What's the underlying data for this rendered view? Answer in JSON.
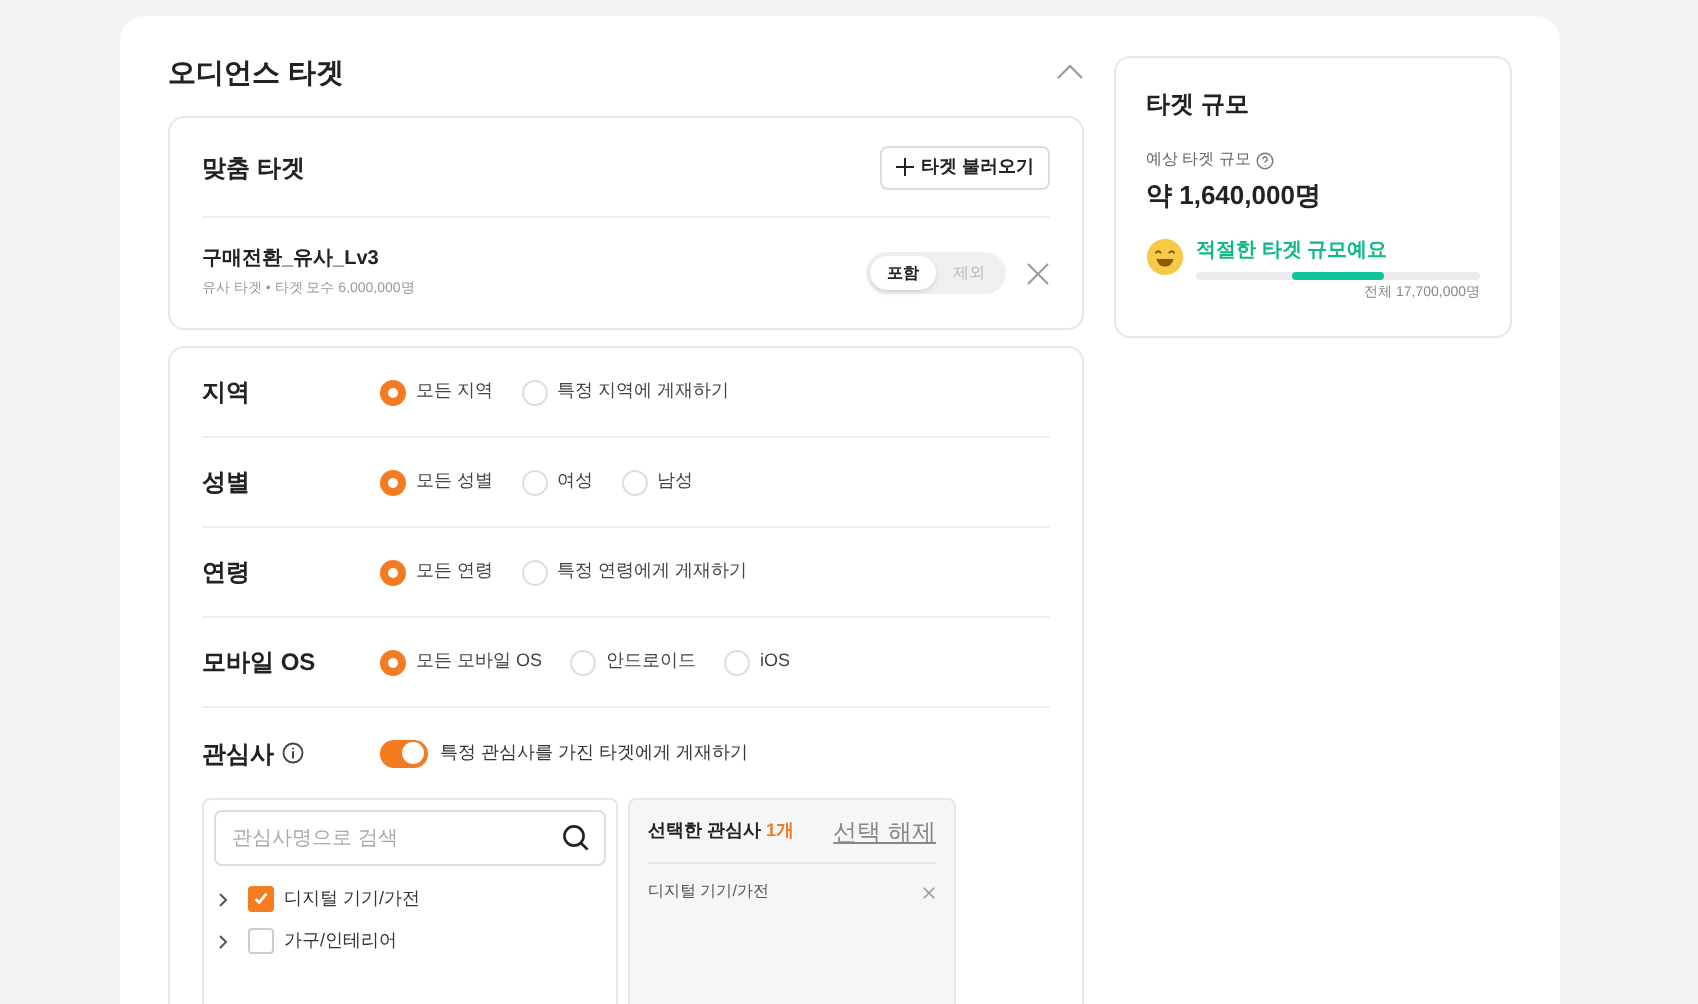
{
  "section": {
    "title": "오디언스 타겟",
    "expanded": true
  },
  "custom_target": {
    "title": "맞춤 타겟",
    "load_button": "타겟 불러오기",
    "items": [
      {
        "name": "구매전환_유사_Lv3",
        "meta": "유사 타겟 • 타겟 모수 6,000,000명",
        "modes": [
          {
            "label": "포함",
            "selected": true
          },
          {
            "label": "제외",
            "selected": false
          }
        ]
      }
    ]
  },
  "filters": [
    {
      "label": "지역",
      "options": [
        {
          "label": "모든 지역",
          "selected": true
        },
        {
          "label": "특정 지역에 게재하기",
          "selected": false
        }
      ]
    },
    {
      "label": "성별",
      "options": [
        {
          "label": "모든 성별",
          "selected": true
        },
        {
          "label": "여성",
          "selected": false
        },
        {
          "label": "남성",
          "selected": false
        }
      ]
    },
    {
      "label": "연령",
      "options": [
        {
          "label": "모든 연령",
          "selected": true
        },
        {
          "label": "특정 연령에게 게재하기",
          "selected": false
        }
      ]
    },
    {
      "label": "모바일 OS",
      "options": [
        {
          "label": "모든 모바일 OS",
          "selected": true
        },
        {
          "label": "안드로이드",
          "selected": false
        },
        {
          "label": "iOS",
          "selected": false
        }
      ]
    }
  ],
  "interests": {
    "label": "관심사",
    "toggle": {
      "on": true,
      "label": "특정 관심사를 가진 타겟에게 게재하기"
    },
    "search": {
      "placeholder": "관심사명으로 검색"
    },
    "categories": [
      {
        "label": "디지털 기기/가전",
        "checked": true
      },
      {
        "label": "가구/인테리어",
        "checked": false
      }
    ],
    "selected_panel": {
      "title": "선택한 관심사",
      "count": "1개",
      "clear": "선택 해제",
      "items": [
        "디지털 기기/가전"
      ]
    }
  },
  "target_size": {
    "title": "타겟 규모",
    "estimate_label": "예상 타겟 규모",
    "estimate": "약 1,640,000명",
    "status": "적절한 타겟 규모예요",
    "total": "전체 17,700,000명"
  }
}
